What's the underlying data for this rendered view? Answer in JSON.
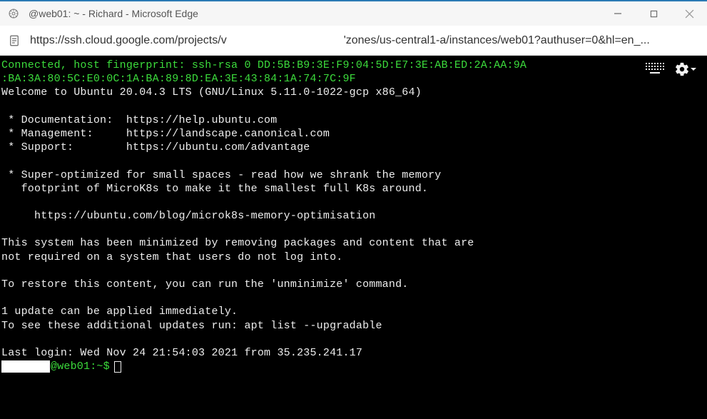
{
  "window": {
    "title": "@web01: ~ - Richard - Microsoft Edge"
  },
  "url": {
    "prefix": "https://ssh.cloud.google.com/projects/v",
    "suffix": "'zones/us-central1-a/instances/web01?authuser=0&hl=en_..."
  },
  "terminal": {
    "fp_line1": "Connected, host fingerprint: ssh-rsa 0 DD:5B:B9:3E:F9:04:5D:E7:3E:AB:ED:2A:AA:9A",
    "fp_line2": ":BA:3A:80:5C:E0:0C:1A:BA:89:8D:EA:3E:43:84:1A:74:7C:9F",
    "welcome": "Welcome to Ubuntu 20.04.3 LTS (GNU/Linux 5.11.0-1022-gcp x86_64)",
    "doc": " * Documentation:  https://help.ubuntu.com",
    "mgmt": " * Management:     https://landscape.canonical.com",
    "support": " * Support:        https://ubuntu.com/advantage",
    "opt1": " * Super-optimized for small spaces - read how we shrank the memory",
    "opt2": "   footprint of MicroK8s to make it the smallest full K8s around.",
    "optlink": "     https://ubuntu.com/blog/microk8s-memory-optimisation",
    "min1": "This system has been minimized by removing packages and content that are",
    "min2": "not required on a system that users do not log into.",
    "restore": "To restore this content, you can run the 'unminimize' command.",
    "upd1": "1 update can be applied immediately.",
    "upd2": "To see these additional updates run: apt list --upgradable",
    "lastlogin": "Last login: Wed Nov 24 21:54:03 2021 from 35.235.241.17",
    "prompt": {
      "host": "@web01",
      "path": ":~",
      "dollar": "$"
    }
  }
}
